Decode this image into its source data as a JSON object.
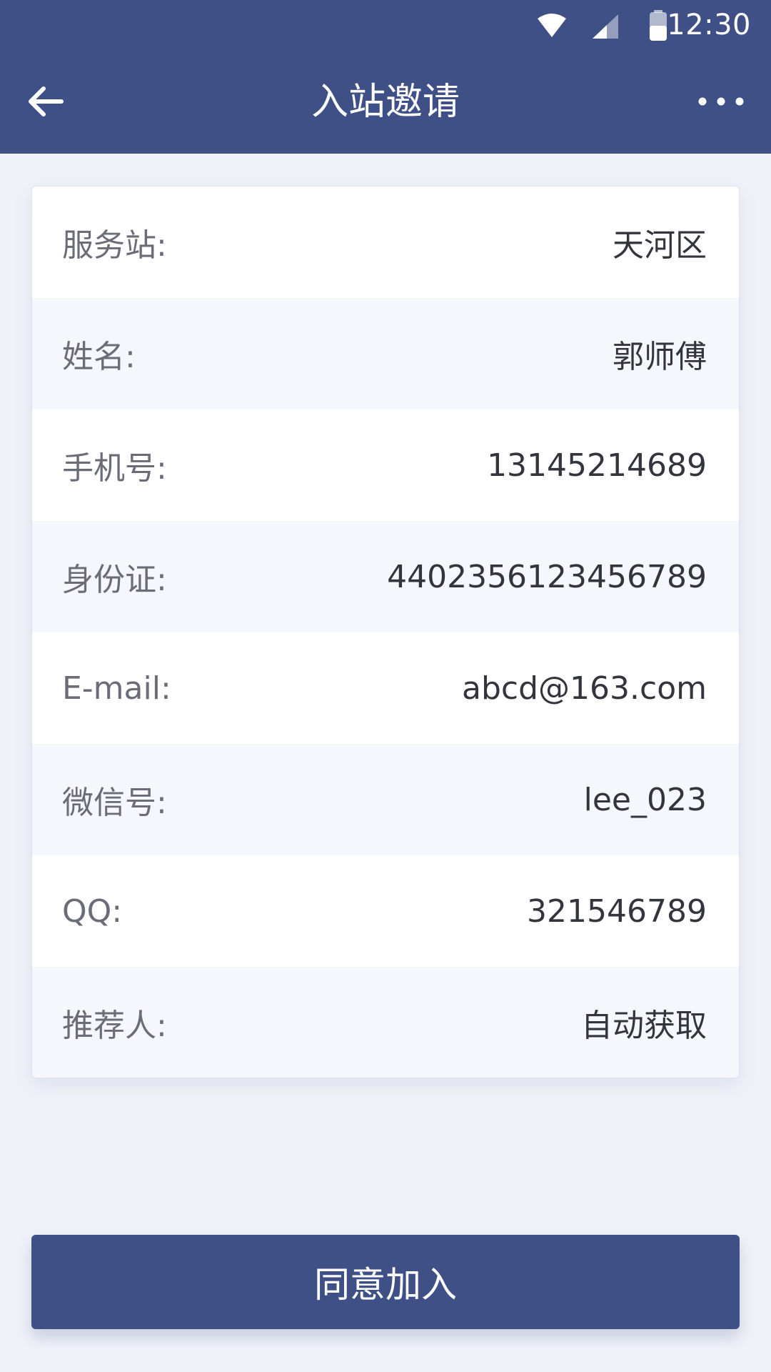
{
  "status_bar": {
    "time": "12:30",
    "icons": [
      "wifi-icon",
      "cell-signal-icon",
      "battery-icon"
    ]
  },
  "nav": {
    "title": "入站邀请",
    "back_icon": "arrow-left-icon",
    "more_icon": "more-dots-icon"
  },
  "info_rows": [
    {
      "label": "服务站:",
      "value": "天河区"
    },
    {
      "label": "姓名:",
      "value": "郭师傅"
    },
    {
      "label": "手机号:",
      "value": "13145214689"
    },
    {
      "label": "身份证:",
      "value": "4402356123456789"
    },
    {
      "label": "E-mail:",
      "value": "abcd@163.com"
    },
    {
      "label": "微信号:",
      "value": "lee_023"
    },
    {
      "label": "QQ:",
      "value": "321546789"
    },
    {
      "label": "推荐人:",
      "value": "自动获取"
    }
  ],
  "actions": {
    "agree_label": "同意加入"
  },
  "colors": {
    "primary": "#3f5087",
    "background": "#f0f2f8",
    "row_alt": "#f5f7fc",
    "label_text": "#6a6d77",
    "value_text": "#33353c"
  }
}
